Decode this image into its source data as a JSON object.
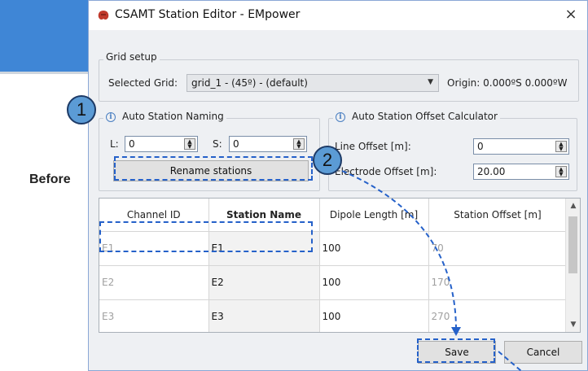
{
  "side_label": "Before",
  "dialog": {
    "title": "CSAMT Station Editor - EMpower",
    "close_glyph": "×",
    "grid_setup": {
      "group_title": "Grid setup",
      "selected_grid_label": "Selected Grid:",
      "selected_grid_value": "grid_1 - (45º) - (default)",
      "origin_text": "Origin: 0.000ºS 0.000ºW"
    },
    "auto_naming": {
      "group_title": "Auto Station Naming",
      "l_label": "L:",
      "l_value": "0",
      "s_label": "S:",
      "s_value": "0",
      "rename_button": "Rename stations"
    },
    "offset_calc": {
      "group_title": "Auto Station Offset Calculator",
      "line_offset_label": "Line Offset [m]:",
      "line_offset_value": "0",
      "electrode_offset_label": "Electrode Offset [m]:",
      "electrode_offset_value": "20.00"
    },
    "table": {
      "columns": [
        "Channel ID",
        "Station Name",
        "Dipole Length [m]",
        "Station Offset [m]"
      ],
      "rows": [
        {
          "channel": "E1",
          "station": "E1",
          "dipole": "100",
          "offset": "70"
        },
        {
          "channel": "E2",
          "station": "E2",
          "dipole": "100",
          "offset": "170"
        },
        {
          "channel": "E3",
          "station": "E3",
          "dipole": "100",
          "offset": "270"
        }
      ]
    },
    "save_button": "Save",
    "cancel_button": "Cancel"
  },
  "callouts": {
    "step1": "1",
    "step2": "2"
  },
  "colors": {
    "accent_blue": "#3f86d6",
    "callout_fill": "#5b9bd5",
    "dash_blue": "#2561c9"
  }
}
